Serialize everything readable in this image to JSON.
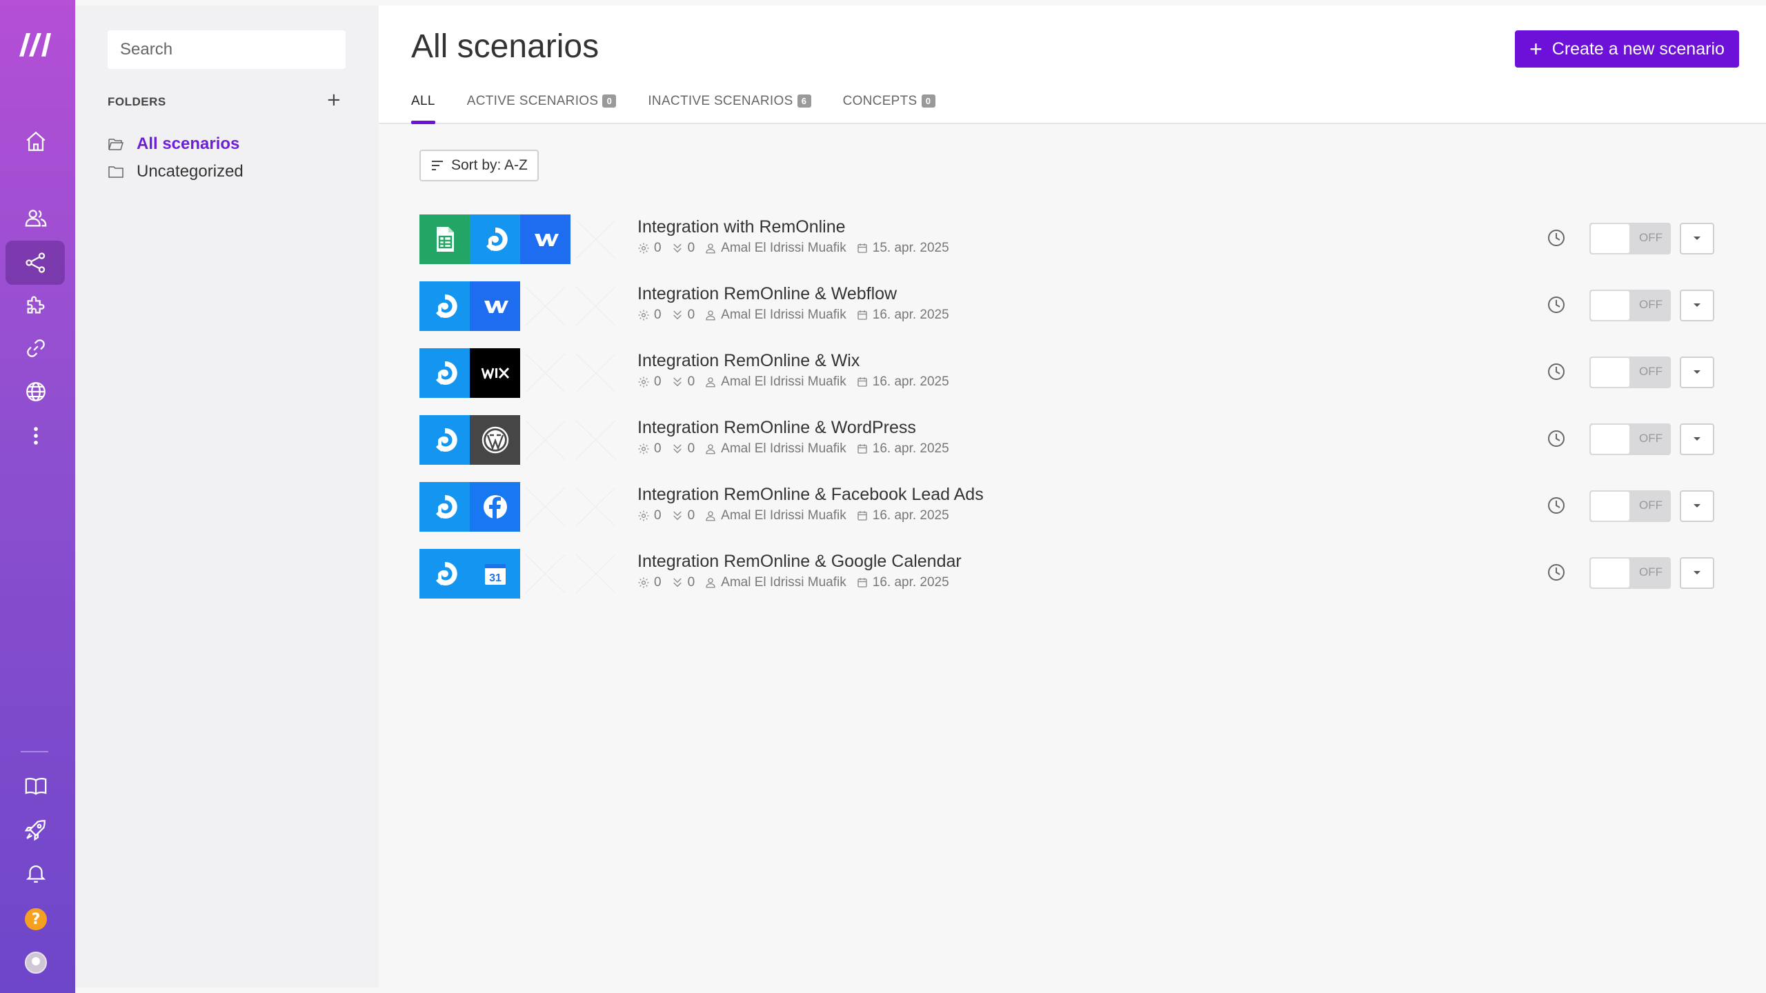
{
  "sidebar": {
    "search_placeholder": "Search",
    "folders_label": "FOLDERS",
    "add_label": "+",
    "items": [
      {
        "label": "All scenarios",
        "icon": "folder-open-icon",
        "active": true
      },
      {
        "label": "Uncategorized",
        "icon": "folder-icon",
        "active": false
      }
    ]
  },
  "rail": {
    "icons": [
      "make-logo-icon",
      "home-icon",
      "team-icon",
      "scenarios-share-icon",
      "puzzle-icon",
      "link-icon",
      "globe-icon",
      "more-vertical-icon",
      "book-icon",
      "rocket-icon",
      "bell-icon",
      "help-icon",
      "avatar"
    ],
    "help_label": "?"
  },
  "header": {
    "title": "All scenarios",
    "create_label": "Create a new scenario",
    "create_plus": "+"
  },
  "tabs": [
    {
      "label": "ALL",
      "badge": null
    },
    {
      "label": "ACTIVE SCENARIOS",
      "badge": "0"
    },
    {
      "label": "INACTIVE SCENARIOS",
      "badge": "6"
    },
    {
      "label": "CONCEPTS",
      "badge": "0"
    }
  ],
  "sort": {
    "label": "Sort by: A-Z"
  },
  "scenarios": [
    {
      "name": "Integration with RemOnline",
      "ops": "0",
      "transfers": "0",
      "author": "Amal El Idrissi Muafik",
      "date": "15. apr. 2025",
      "status": "OFF",
      "apps": [
        "google-sheets",
        "remonline",
        "webflow"
      ]
    },
    {
      "name": "Integration RemOnline & Webflow",
      "ops": "0",
      "transfers": "0",
      "author": "Amal El Idrissi Muafik",
      "date": "16. apr. 2025",
      "status": "OFF",
      "apps": [
        "remonline",
        "webflow"
      ]
    },
    {
      "name": "Integration RemOnline & Wix",
      "ops": "0",
      "transfers": "0",
      "author": "Amal El Idrissi Muafik",
      "date": "16. apr. 2025",
      "status": "OFF",
      "apps": [
        "remonline",
        "wix"
      ]
    },
    {
      "name": "Integration RemOnline & WordPress",
      "ops": "0",
      "transfers": "0",
      "author": "Amal El Idrissi Muafik",
      "date": "16. apr. 2025",
      "status": "OFF",
      "apps": [
        "remonline",
        "wordpress"
      ]
    },
    {
      "name": "Integration RemOnline & Facebook Lead Ads",
      "ops": "0",
      "transfers": "0",
      "author": "Amal El Idrissi Muafik",
      "date": "16. apr. 2025",
      "status": "OFF",
      "apps": [
        "remonline",
        "facebook"
      ]
    },
    {
      "name": "Integration RemOnline & Google Calendar",
      "ops": "0",
      "transfers": "0",
      "author": "Amal El Idrissi Muafik",
      "date": "16. apr. 2025",
      "status": "OFF",
      "apps": [
        "remonline",
        "google-calendar"
      ],
      "calendar_day": "31"
    }
  ],
  "colors": {
    "accent": "#6d10d8",
    "sheets": "#23a566",
    "remonline": "#1495f0",
    "webflow": "#1e6cf0",
    "wix": "#000000",
    "wordpress": "#464646",
    "facebook": "#1778f2",
    "calendar": "#1a73e8"
  }
}
